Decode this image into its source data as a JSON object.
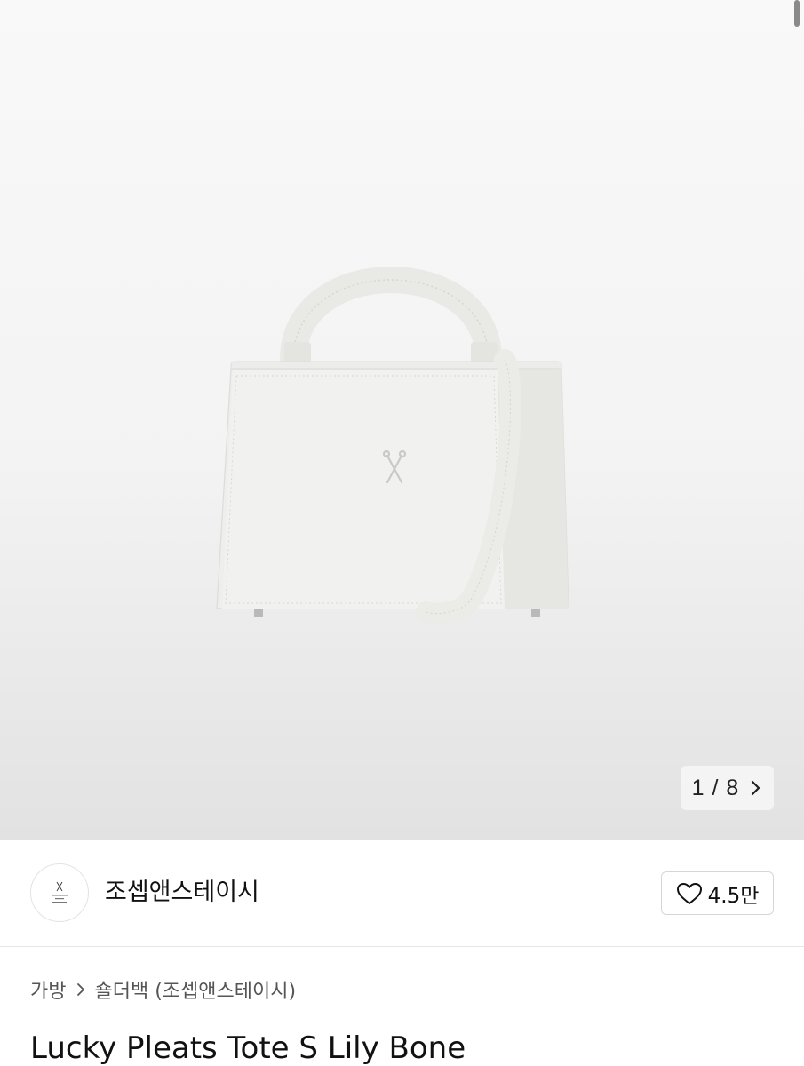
{
  "gallery": {
    "image_alt": "Lucky Pleats Tote S Lily Bone",
    "current": "1",
    "separator": "/",
    "total": "8",
    "counter_text": "1 / 8"
  },
  "store": {
    "name": "조셉앤스테이시",
    "logo_text": "JOSEPH AND STACEY",
    "likes": "4.5만"
  },
  "breadcrumb": {
    "category": "가방",
    "subcategory": "숄더백 (조셉앤스테이시)"
  },
  "product": {
    "title": "Lucky Pleats Tote S Lily Bone"
  },
  "icons": {
    "next": "chevron-right-icon",
    "like": "heart-icon",
    "breadcrumb_separator": "chevron-right-icon"
  }
}
